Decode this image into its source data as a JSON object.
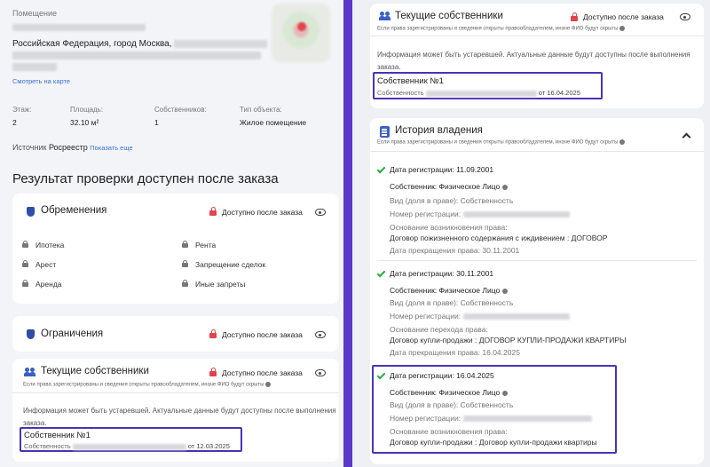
{
  "left": {
    "address": {
      "label": "Помещение",
      "line1": "Российская Федерация, город Москва,",
      "map_link": "Смотреть на карте"
    },
    "stats": [
      {
        "label": "Этаж:",
        "value": "2"
      },
      {
        "label": "Площадь:",
        "value": "32.10 м²"
      },
      {
        "label": "Собственников:",
        "value": "1"
      },
      {
        "label": "Тип объекта:",
        "value": "Жилое помещение"
      }
    ],
    "source": {
      "label": "Источник",
      "value": "Росреестр",
      "more": "Показать еще"
    },
    "result_title": "Результат проверки доступен после заказа",
    "encumbrances": {
      "title": "Обременения",
      "lock_text": "Доступно после заказа",
      "items": [
        "Ипотека",
        "Рента",
        "Арест",
        "Запрещение сделок",
        "Аренда",
        "Иные запреты"
      ]
    },
    "restrictions": {
      "title": "Ограничения",
      "lock_text": "Доступно после заказа"
    },
    "current_owners": {
      "title": "Текущие собственники",
      "lock_text": "Доступно после заказа",
      "note": "Если права зарегистрированы и сведения открыты правообладателем, иначе ФИО будут скрыты",
      "info_line1": "Информация может быть устаревшей. Актуальные данные будут доступны после выполнения",
      "info_line2": "заказа.",
      "owner_name": "Собственник №1",
      "owner_label": "Собственность",
      "owner_date": "от 12.03.2025"
    }
  },
  "right": {
    "current_owners": {
      "title": "Текущие собственники",
      "lock_text": "Доступно после заказа",
      "note": "Если права зарегистрированы и сведения открыты правообладателем, иначе ФИО будут скрыты",
      "info_line1": "Информация может быть устаревшей. Актуальные данные будут доступны после выполнения",
      "info_line2": "заказа.",
      "owner_name": "Собственник №1",
      "owner_label": "Собственность",
      "owner_date": "от 16.04.2025"
    },
    "history": {
      "title": "История владения",
      "note": "Если права зарегистрированы и сведения открыты правообладателем, иначе ФИО будут скрыты",
      "entries": [
        {
          "reg_date": "Дата регистрации: 11.09.2001",
          "owner": "Собственник: Физическое Лицо",
          "share": "Вид (доля в праве): Собственность",
          "reg_number": "Номер регистрации:",
          "basis_label": "Основание возникновения права:",
          "basis": "Договор пожизненного содержания с иждивением : ДОГОВОР",
          "end_date": "Дата прекращения права: 30.11.2001"
        },
        {
          "reg_date": "Дата регистрации: 30.11.2001",
          "owner": "Собственник: Физическое Лицо",
          "share": "Вид (доля в праве): Собственность",
          "reg_number": "Номер регистрации:",
          "basis_label": "Основание перехода права:",
          "basis": "Договор купли-продажи : ДОГОВОР КУПЛИ-ПРОДАЖИ КВАРТИРЫ",
          "end_date": "Дата прекращения права: 16.04.2025"
        },
        {
          "reg_date": "Дата регистрации: 16.04.2025",
          "owner": "Собственник: Физическое Лицо",
          "share": "Вид (доля в праве): Собственность",
          "reg_number": "Номер регистрации:",
          "basis_label": "Основание возникновения права:",
          "basis": "Договор купли-продажи : Договор купли-продажи квартиры"
        }
      ]
    }
  }
}
